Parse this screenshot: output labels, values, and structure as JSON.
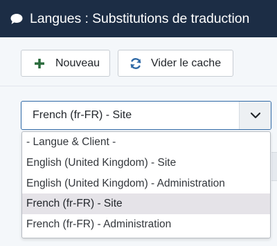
{
  "header": {
    "title": "Langues : Substitutions de traduction",
    "icon": "comment-icon"
  },
  "toolbar": {
    "new_label": "Nouveau",
    "new_icon": "plus-icon",
    "cache_label": "Vider le cache",
    "cache_icon": "refresh-icon"
  },
  "filter": {
    "selected": "French (fr-FR) - Site",
    "options": [
      "- Langue & Client -",
      "English (United Kingdom) - Site",
      "English (United Kingdom) - Administration",
      "French (fr-FR) - Site",
      "French (fr-FR) - Administration"
    ],
    "selected_index": 3
  },
  "colors": {
    "header_bg": "#1c2d45",
    "accent": "#2f69a6",
    "plus": "#2a6b3c",
    "selected_option_bg": "#e5e3e8"
  }
}
